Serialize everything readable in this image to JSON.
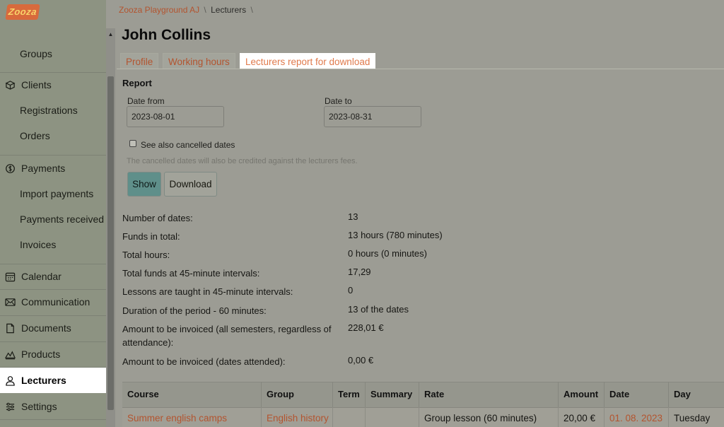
{
  "brand": {
    "logo_text": "Zooza"
  },
  "sidebar": {
    "items": [
      {
        "label": "Groups",
        "icon": "",
        "sub": true
      },
      {
        "label": "Clients",
        "icon": "clients-icon",
        "sub": false
      },
      {
        "label": "Registrations",
        "icon": "",
        "sub": true
      },
      {
        "label": "Orders",
        "icon": "",
        "sub": true
      },
      {
        "label": "Payments",
        "icon": "payments-icon",
        "sub": false
      },
      {
        "label": "Import payments",
        "icon": "",
        "sub": true
      },
      {
        "label": "Payments received",
        "icon": "",
        "sub": true
      },
      {
        "label": "Invoices",
        "icon": "",
        "sub": true
      },
      {
        "label": "Calendar",
        "icon": "calendar-icon",
        "sub": false
      },
      {
        "label": "Communication",
        "icon": "envelope-icon",
        "sub": false
      },
      {
        "label": "Documents",
        "icon": "document-icon",
        "sub": false
      },
      {
        "label": "Products",
        "icon": "products-icon",
        "sub": false
      },
      {
        "label": "Lecturers",
        "icon": "user-icon",
        "sub": false,
        "active": true
      },
      {
        "label": "Settings",
        "icon": "settings-icon",
        "sub": false
      }
    ]
  },
  "breadcrumb": {
    "root": "Zooza Playground AJ",
    "current": "Lecturers",
    "separator": "\\"
  },
  "page": {
    "title": "John Collins"
  },
  "tabs": [
    {
      "label": "Profile",
      "active": false
    },
    {
      "label": "Working hours",
      "active": false
    },
    {
      "label": "Lecturers report for download",
      "active": true
    }
  ],
  "report": {
    "heading": "Report",
    "date_from_label": "Date from",
    "date_from_value": "2023-08-01",
    "date_to_label": "Date to",
    "date_to_value": "2023-08-31",
    "checkbox_label": "See also cancelled dates",
    "checkbox_checked": false,
    "hint": "The cancelled dates will also be credited against the lecturers fees.",
    "show_button": "Show",
    "download_button": "Download"
  },
  "stats": [
    {
      "label": "Number of dates:",
      "value": "13"
    },
    {
      "label": "Funds in total:",
      "value": "13 hours (780 minutes)"
    },
    {
      "label": "Total hours:",
      "value": "0 hours (0 minutes)"
    },
    {
      "label": "Total funds at 45-minute intervals:",
      "value": "17,29"
    },
    {
      "label": "Lessons are taught in 45-minute intervals:",
      "value": "0"
    },
    {
      "label": "Duration of the period - 60 minutes:",
      "value": "13 of the dates"
    },
    {
      "label": "Amount to be invoiced (all semesters, regardless of attendance):",
      "value": "228,01 €"
    },
    {
      "label": "Amount to be invoiced (dates attended):",
      "value": "0,00 €"
    }
  ],
  "table": {
    "headers": [
      "Course",
      "Group",
      "Term",
      "Summary",
      "Rate",
      "Amount",
      "Date",
      "Day"
    ],
    "rows": [
      {
        "course": "Summer english camps",
        "group": "English history",
        "term": "",
        "summary": "",
        "rate": "Group lesson (60 minutes)",
        "amount": "20,00 €",
        "date": "01. 08. 2023",
        "day": "Tuesday"
      }
    ]
  },
  "colors": {
    "accent": "#e07a4b",
    "link": "#b3542f",
    "primary_button": "#5f8f8a",
    "sidebar_bg": "#8d9382"
  }
}
